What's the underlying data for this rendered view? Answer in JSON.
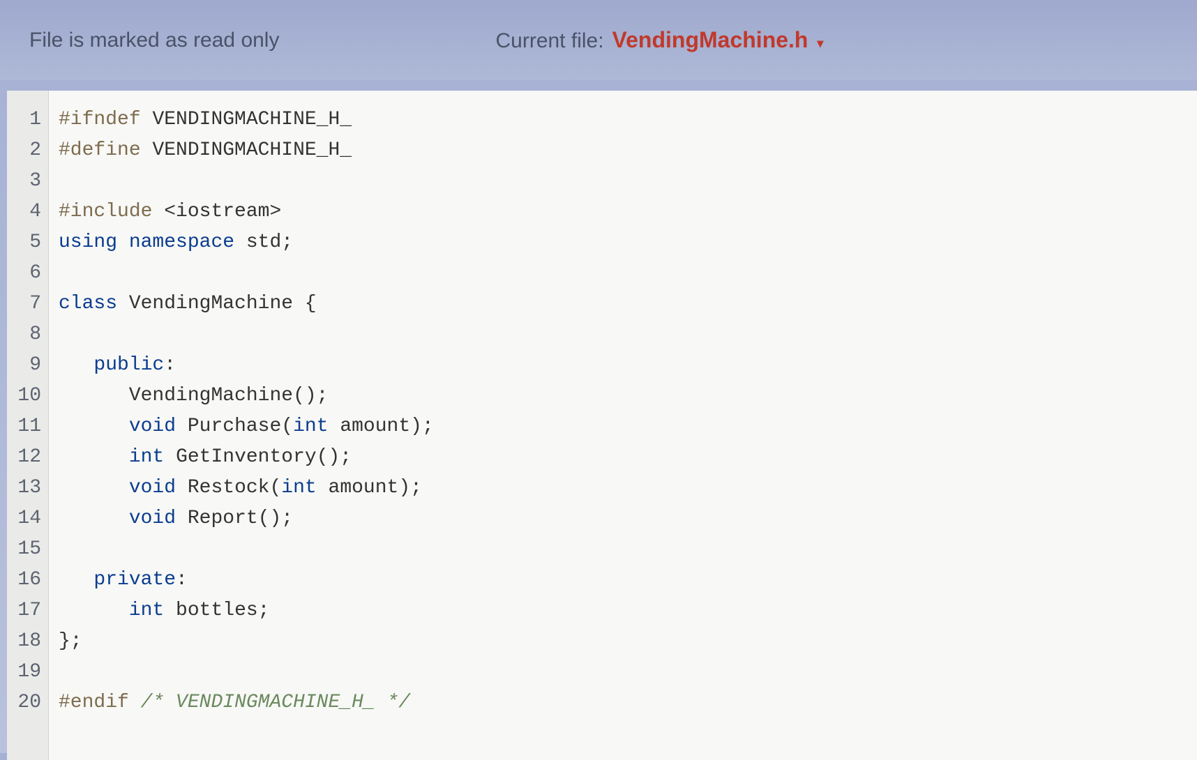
{
  "header": {
    "readonly_text": "File is marked as read only",
    "current_file_label": "Current file:",
    "current_file_name": "VendingMachine.h"
  },
  "editor": {
    "line_numbers": [
      "1",
      "2",
      "3",
      "4",
      "5",
      "6",
      "7",
      "8",
      "9",
      "10",
      "11",
      "12",
      "13",
      "14",
      "15",
      "16",
      "17",
      "18",
      "19",
      "20"
    ],
    "lines": [
      {
        "segments": [
          {
            "t": "#ifndef",
            "c": "preproc"
          },
          {
            "t": " ",
            "c": "plain"
          },
          {
            "t": "VENDINGMACHINE_H_",
            "c": "ident"
          }
        ]
      },
      {
        "segments": [
          {
            "t": "#define",
            "c": "preproc"
          },
          {
            "t": " ",
            "c": "plain"
          },
          {
            "t": "VENDINGMACHINE_H_",
            "c": "ident"
          }
        ]
      },
      {
        "segments": [
          {
            "t": "",
            "c": "plain"
          }
        ]
      },
      {
        "segments": [
          {
            "t": "#include",
            "c": "preproc"
          },
          {
            "t": " ",
            "c": "plain"
          },
          {
            "t": "<iostream>",
            "c": "ident"
          }
        ]
      },
      {
        "segments": [
          {
            "t": "using",
            "c": "keyword"
          },
          {
            "t": " ",
            "c": "plain"
          },
          {
            "t": "namespace",
            "c": "keyword"
          },
          {
            "t": " ",
            "c": "plain"
          },
          {
            "t": "std",
            "c": "ident"
          },
          {
            "t": ";",
            "c": "punct"
          }
        ]
      },
      {
        "segments": [
          {
            "t": "",
            "c": "plain"
          }
        ]
      },
      {
        "segments": [
          {
            "t": "class",
            "c": "keyword"
          },
          {
            "t": " ",
            "c": "plain"
          },
          {
            "t": "VendingMachine",
            "c": "ident"
          },
          {
            "t": " {",
            "c": "punct"
          }
        ]
      },
      {
        "segments": [
          {
            "t": "",
            "c": "plain"
          }
        ]
      },
      {
        "segments": [
          {
            "t": "   ",
            "c": "plain"
          },
          {
            "t": "public",
            "c": "keyword"
          },
          {
            "t": ":",
            "c": "punct"
          }
        ]
      },
      {
        "segments": [
          {
            "t": "      ",
            "c": "plain"
          },
          {
            "t": "VendingMachine",
            "c": "ident"
          },
          {
            "t": "();",
            "c": "punct"
          }
        ]
      },
      {
        "segments": [
          {
            "t": "      ",
            "c": "plain"
          },
          {
            "t": "void",
            "c": "type"
          },
          {
            "t": " ",
            "c": "plain"
          },
          {
            "t": "Purchase",
            "c": "ident"
          },
          {
            "t": "(",
            "c": "punct"
          },
          {
            "t": "int",
            "c": "type"
          },
          {
            "t": " amount",
            "c": "ident"
          },
          {
            "t": ");",
            "c": "punct"
          }
        ]
      },
      {
        "segments": [
          {
            "t": "      ",
            "c": "plain"
          },
          {
            "t": "int",
            "c": "type"
          },
          {
            "t": " ",
            "c": "plain"
          },
          {
            "t": "GetInventory",
            "c": "ident"
          },
          {
            "t": "();",
            "c": "punct"
          }
        ]
      },
      {
        "segments": [
          {
            "t": "      ",
            "c": "plain"
          },
          {
            "t": "void",
            "c": "type"
          },
          {
            "t": " ",
            "c": "plain"
          },
          {
            "t": "Restock",
            "c": "ident"
          },
          {
            "t": "(",
            "c": "punct"
          },
          {
            "t": "int",
            "c": "type"
          },
          {
            "t": " amount",
            "c": "ident"
          },
          {
            "t": ");",
            "c": "punct"
          }
        ]
      },
      {
        "segments": [
          {
            "t": "      ",
            "c": "plain"
          },
          {
            "t": "void",
            "c": "type"
          },
          {
            "t": " ",
            "c": "plain"
          },
          {
            "t": "Report",
            "c": "ident"
          },
          {
            "t": "();",
            "c": "punct"
          }
        ]
      },
      {
        "segments": [
          {
            "t": "",
            "c": "plain"
          }
        ]
      },
      {
        "segments": [
          {
            "t": "   ",
            "c": "plain"
          },
          {
            "t": "private",
            "c": "keyword"
          },
          {
            "t": ":",
            "c": "punct"
          }
        ]
      },
      {
        "segments": [
          {
            "t": "      ",
            "c": "plain"
          },
          {
            "t": "int",
            "c": "type"
          },
          {
            "t": " bottles",
            "c": "ident"
          },
          {
            "t": ";",
            "c": "punct"
          }
        ]
      },
      {
        "segments": [
          {
            "t": "};",
            "c": "punct"
          }
        ]
      },
      {
        "segments": [
          {
            "t": "",
            "c": "plain"
          }
        ]
      },
      {
        "segments": [
          {
            "t": "#endif",
            "c": "preproc"
          },
          {
            "t": " ",
            "c": "plain"
          },
          {
            "t": "/* VENDINGMACHINE_H_ */",
            "c": "comment"
          }
        ]
      }
    ]
  }
}
